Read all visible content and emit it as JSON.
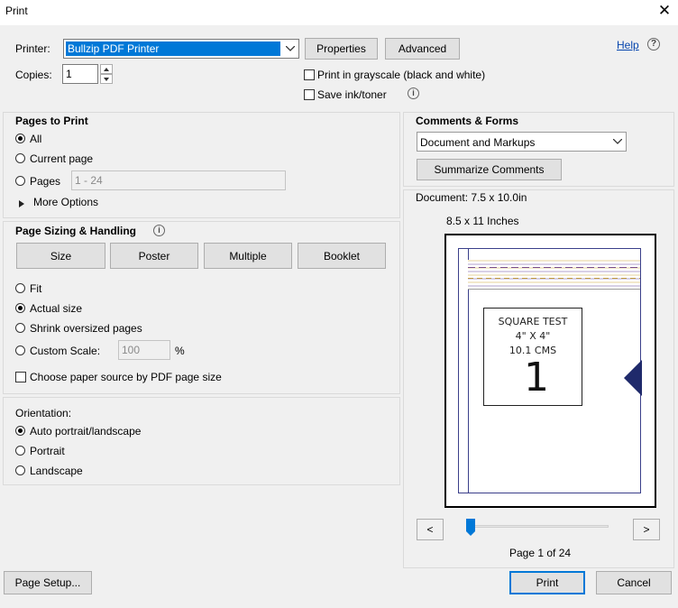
{
  "window": {
    "title": "Print",
    "close_glyph": "✕"
  },
  "printer": {
    "label": "Printer:",
    "value": "Bullzip PDF Printer",
    "properties": "Properties",
    "advanced": "Advanced"
  },
  "help": {
    "label": "Help",
    "glyph": "?"
  },
  "copies": {
    "label": "Copies:",
    "value": "1"
  },
  "options": {
    "grayscale": "Print in grayscale (black and white)",
    "save_ink": "Save ink/toner"
  },
  "pages_to_print": {
    "heading": "Pages to Print",
    "all": "All",
    "current": "Current page",
    "pages": "Pages",
    "pages_value": "1 - 24",
    "more_options": "More Options"
  },
  "sizing": {
    "heading": "Page Sizing & Handling",
    "tabs": [
      "Size",
      "Poster",
      "Multiple",
      "Booklet"
    ],
    "fit": "Fit",
    "actual": "Actual size",
    "shrink": "Shrink oversized pages",
    "custom": "Custom Scale:",
    "custom_value": "100",
    "percent": "%",
    "paper_source": "Choose paper source by PDF page size"
  },
  "orientation": {
    "heading": "Orientation:",
    "auto": "Auto portrait/landscape",
    "portrait": "Portrait",
    "landscape": "Landscape"
  },
  "comments": {
    "heading": "Comments & Forms",
    "value": "Document and Markups",
    "summarize": "Summarize Comments"
  },
  "preview": {
    "document": "Document: 7.5 x 10.0in",
    "paper": "8.5 x 11 Inches",
    "box_lines": [
      "SQUARE TEST",
      "4\" X 4\"",
      "10.1 CMS"
    ],
    "box_number": "1",
    "prev": "<",
    "next": ">",
    "page_status": "Page 1 of 24"
  },
  "footer": {
    "page_setup": "Page Setup...",
    "print": "Print",
    "cancel": "Cancel"
  }
}
